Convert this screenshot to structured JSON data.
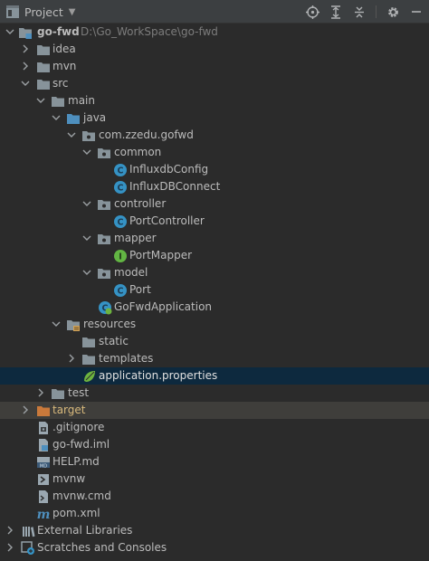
{
  "header": {
    "title": "Project",
    "icons": [
      "locate-icon",
      "expand-all-icon",
      "collapse-all-icon",
      "gear-icon",
      "minimize-icon"
    ]
  },
  "colors": {
    "background": "#2b2b2b",
    "header": "#3c3f41",
    "selected_row": "#0d293e",
    "excluded_row": "#3f3e3b",
    "folder": "#87939a",
    "class_icon": "#3592c4",
    "interface_icon": "#62b543",
    "excluded_folder": "#c9793b"
  },
  "tree": {
    "root": {
      "label": "go-fwd",
      "path": "D:\\Go_WorkSpace\\go-fwd"
    },
    "idea": "idea",
    "mvn": "mvn",
    "src": "src",
    "main": "main",
    "java": "java",
    "package": "com.zzedu.gofwd",
    "common": "common",
    "influxdb_config": "InfluxdbConfig",
    "influxdb_connect": "InfluxDBConnect",
    "controller": "controller",
    "port_controller": "PortController",
    "mapper": "mapper",
    "port_mapper": "PortMapper",
    "model": "model",
    "port": "Port",
    "application_class": "GoFwdApplication",
    "resources": "resources",
    "static": "static",
    "templates": "templates",
    "application_properties": "application.properties",
    "test": "test",
    "target": "target",
    "gitignore": ".gitignore",
    "iml": "go-fwd.iml",
    "help": "HELP.md",
    "mvnw": "mvnw",
    "mvnw_cmd": "mvnw.cmd",
    "pom": "pom.xml",
    "external_libraries": "External Libraries",
    "scratches": "Scratches and Consoles"
  }
}
